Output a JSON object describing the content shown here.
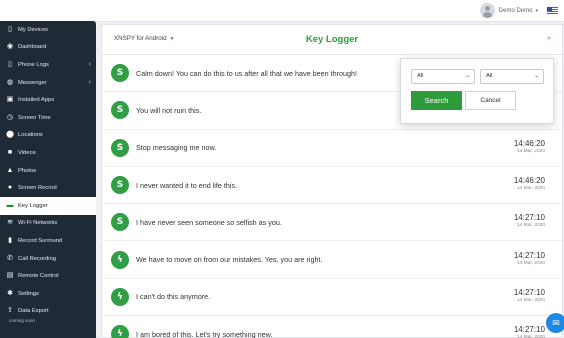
{
  "header": {
    "user_name": "Demo Demo",
    "caret": "▾"
  },
  "sidebar": {
    "items": [
      {
        "label": "My Devices",
        "icon": "phone-icon"
      },
      {
        "label": "Dashboard",
        "icon": "dashboard-icon"
      },
      {
        "label": "Phone Logs",
        "icon": "phone-icon",
        "chevron": "›"
      },
      {
        "label": "Messenger",
        "icon": "messenger-icon",
        "chevron": "›"
      },
      {
        "label": "Installed Apps",
        "icon": "apps-icon"
      },
      {
        "label": "Screen Time",
        "icon": "clock-icon"
      },
      {
        "label": "Locations",
        "icon": "location-icon"
      },
      {
        "label": "Videos",
        "icon": "video-icon"
      },
      {
        "label": "Photos",
        "icon": "photo-icon"
      },
      {
        "label": "Screen Record",
        "icon": "record-icon"
      },
      {
        "label": "Key Logger",
        "icon": "keyboard-icon",
        "active": true
      },
      {
        "label": "Wi-Fi Networks",
        "icon": "wifi-icon"
      },
      {
        "label": "Record Surround",
        "icon": "microphone-icon"
      },
      {
        "label": "Call Recording",
        "icon": "call-icon"
      },
      {
        "label": "Remote Control",
        "icon": "remote-icon"
      },
      {
        "label": "Settings",
        "icon": "gear-icon"
      },
      {
        "label": "Data Export",
        "icon": "upload-icon"
      }
    ],
    "coming_soon": "coming soon"
  },
  "panel": {
    "device_label": "XNSPY for Android",
    "title": "Key Logger"
  },
  "rows": [
    {
      "app": "skype",
      "glyph": "S",
      "text": "Calm down! You can do this to us after all that we have been through!",
      "time": "",
      "date": ""
    },
    {
      "app": "skype",
      "glyph": "S",
      "text": "You will not ruin this.",
      "time": "",
      "date": ""
    },
    {
      "app": "skype",
      "glyph": "S",
      "text": "Stop messaging me now.",
      "time": "14:46:20",
      "date": "14 Mar, 2020"
    },
    {
      "app": "skype",
      "glyph": "S",
      "text": "I never wanted it to end life this.",
      "time": "14:46:20",
      "date": "14 Mar, 2020"
    },
    {
      "app": "skype",
      "glyph": "S",
      "text": "I have never seen someone so selfish as you.",
      "time": "14:27:10",
      "date": "14 Mar, 2020"
    },
    {
      "app": "messenger",
      "glyph": "ϟ",
      "text": "We have to move on from our mistakes. Yes, you are right.",
      "time": "14:27:10",
      "date": "14 Mar, 2020"
    },
    {
      "app": "messenger",
      "glyph": "ϟ",
      "text": "I can't do this anymore.",
      "time": "14:27:10",
      "date": "14 Mar, 2020"
    },
    {
      "app": "messenger",
      "glyph": "ϟ",
      "text": "I am bored of this. Let's try something new.",
      "time": "14:27:10",
      "date": "14 Mar, 2020"
    }
  ],
  "search_popup": {
    "select_1": "All",
    "select_2": "All",
    "search_label": "Search",
    "cancel_label": "Cancel"
  },
  "colors": {
    "brand_green": "#2e9b3a",
    "sidebar_bg": "#1f2a37"
  }
}
